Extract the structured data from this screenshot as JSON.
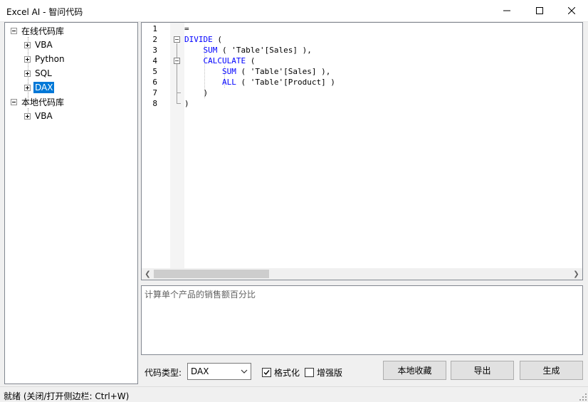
{
  "window": {
    "title": "Excel AI - 智问代码",
    "minimize_icon": "minimize-icon",
    "maximize_icon": "maximize-icon",
    "close_icon": "close-icon"
  },
  "tree": {
    "groups": [
      {
        "label": "在线代码库",
        "expanded": true,
        "children": [
          {
            "label": "VBA"
          },
          {
            "label": "Python"
          },
          {
            "label": "SQL"
          },
          {
            "label": "DAX",
            "selected": true
          }
        ]
      },
      {
        "label": "本地代码库",
        "expanded": true,
        "children": [
          {
            "label": "VBA"
          }
        ]
      }
    ]
  },
  "editor": {
    "line_numbers": [
      "1",
      "2",
      "3",
      "4",
      "5",
      "6",
      "7",
      "8"
    ],
    "lines": [
      [
        {
          "t": "="
        }
      ],
      [
        {
          "t": "DIVIDE",
          "kw": true
        },
        {
          "t": " ("
        }
      ],
      [
        {
          "t": "    "
        },
        {
          "t": "SUM",
          "kw": true
        },
        {
          "t": " ( 'Table'[Sales] ),"
        }
      ],
      [
        {
          "t": "    "
        },
        {
          "t": "CALCULATE",
          "kw": true
        },
        {
          "t": " ("
        }
      ],
      [
        {
          "t": "        "
        },
        {
          "t": "SUM",
          "kw": true
        },
        {
          "t": " ( 'Table'[Sales] ),"
        }
      ],
      [
        {
          "t": "        "
        },
        {
          "t": "ALL",
          "kw": true
        },
        {
          "t": " ( 'Table'[Product] )"
        }
      ],
      [
        {
          "t": "    )"
        }
      ],
      [
        {
          "t": ")"
        }
      ]
    ],
    "keyword_color": "#0000ff"
  },
  "description": {
    "text": "计算单个产品的销售额百分比"
  },
  "controls": {
    "code_type_label": "代码类型:",
    "code_type_value": "DAX",
    "format_label": "格式化",
    "format_checked": true,
    "enhanced_label": "增强版",
    "enhanced_checked": false,
    "save_local_label": "本地收藏",
    "export_label": "导出",
    "generate_label": "生成"
  },
  "status": {
    "text": "就绪 (关闭/打开侧边栏: Ctrl+W)"
  },
  "colors": {
    "selection": "#0078d7"
  }
}
